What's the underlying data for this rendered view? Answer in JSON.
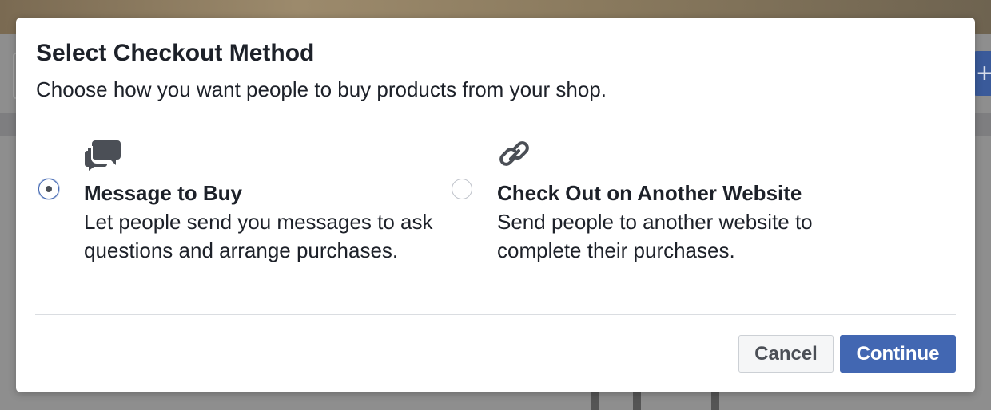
{
  "dialog": {
    "title": "Select Checkout Method",
    "subtitle": "Choose how you want people to buy products from your shop.",
    "options": [
      {
        "icon": "chat-bubbles-icon",
        "title": "Message to Buy",
        "description": "Let people send you messages to ask questions and arrange purchases.",
        "selected": true
      },
      {
        "icon": "link-icon",
        "title": "Check Out on Another Website",
        "description": "Send people to another website to complete their purchases.",
        "selected": false
      }
    ],
    "buttons": {
      "cancel_label": "Cancel",
      "continue_label": "Continue"
    }
  },
  "background": {
    "plus_label": "+"
  },
  "colors": {
    "primary": "#4267b2",
    "text": "#1d2129",
    "overlay": "#8e8e8e"
  }
}
